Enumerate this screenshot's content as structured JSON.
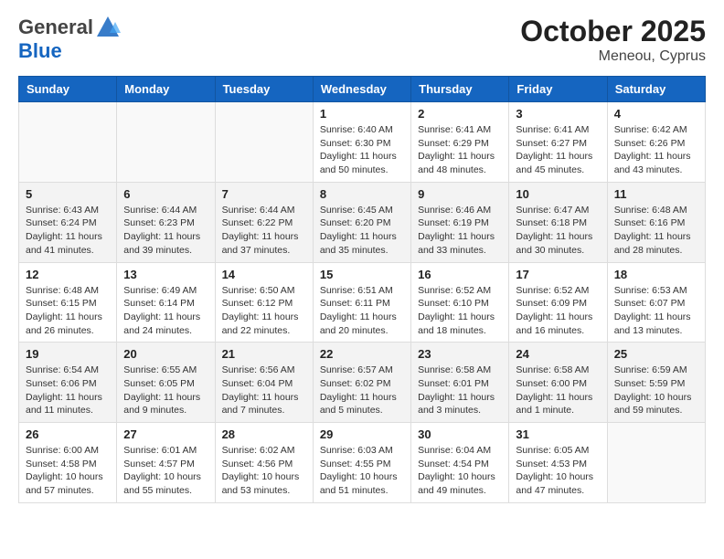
{
  "header": {
    "logo_line1": "General",
    "logo_line2": "Blue",
    "month": "October 2025",
    "location": "Meneou, Cyprus"
  },
  "days_of_week": [
    "Sunday",
    "Monday",
    "Tuesday",
    "Wednesday",
    "Thursday",
    "Friday",
    "Saturday"
  ],
  "weeks": [
    [
      {
        "day": "",
        "info": ""
      },
      {
        "day": "",
        "info": ""
      },
      {
        "day": "",
        "info": ""
      },
      {
        "day": "1",
        "info": "Sunrise: 6:40 AM\nSunset: 6:30 PM\nDaylight: 11 hours\nand 50 minutes."
      },
      {
        "day": "2",
        "info": "Sunrise: 6:41 AM\nSunset: 6:29 PM\nDaylight: 11 hours\nand 48 minutes."
      },
      {
        "day": "3",
        "info": "Sunrise: 6:41 AM\nSunset: 6:27 PM\nDaylight: 11 hours\nand 45 minutes."
      },
      {
        "day": "4",
        "info": "Sunrise: 6:42 AM\nSunset: 6:26 PM\nDaylight: 11 hours\nand 43 minutes."
      }
    ],
    [
      {
        "day": "5",
        "info": "Sunrise: 6:43 AM\nSunset: 6:24 PM\nDaylight: 11 hours\nand 41 minutes."
      },
      {
        "day": "6",
        "info": "Sunrise: 6:44 AM\nSunset: 6:23 PM\nDaylight: 11 hours\nand 39 minutes."
      },
      {
        "day": "7",
        "info": "Sunrise: 6:44 AM\nSunset: 6:22 PM\nDaylight: 11 hours\nand 37 minutes."
      },
      {
        "day": "8",
        "info": "Sunrise: 6:45 AM\nSunset: 6:20 PM\nDaylight: 11 hours\nand 35 minutes."
      },
      {
        "day": "9",
        "info": "Sunrise: 6:46 AM\nSunset: 6:19 PM\nDaylight: 11 hours\nand 33 minutes."
      },
      {
        "day": "10",
        "info": "Sunrise: 6:47 AM\nSunset: 6:18 PM\nDaylight: 11 hours\nand 30 minutes."
      },
      {
        "day": "11",
        "info": "Sunrise: 6:48 AM\nSunset: 6:16 PM\nDaylight: 11 hours\nand 28 minutes."
      }
    ],
    [
      {
        "day": "12",
        "info": "Sunrise: 6:48 AM\nSunset: 6:15 PM\nDaylight: 11 hours\nand 26 minutes."
      },
      {
        "day": "13",
        "info": "Sunrise: 6:49 AM\nSunset: 6:14 PM\nDaylight: 11 hours\nand 24 minutes."
      },
      {
        "day": "14",
        "info": "Sunrise: 6:50 AM\nSunset: 6:12 PM\nDaylight: 11 hours\nand 22 minutes."
      },
      {
        "day": "15",
        "info": "Sunrise: 6:51 AM\nSunset: 6:11 PM\nDaylight: 11 hours\nand 20 minutes."
      },
      {
        "day": "16",
        "info": "Sunrise: 6:52 AM\nSunset: 6:10 PM\nDaylight: 11 hours\nand 18 minutes."
      },
      {
        "day": "17",
        "info": "Sunrise: 6:52 AM\nSunset: 6:09 PM\nDaylight: 11 hours\nand 16 minutes."
      },
      {
        "day": "18",
        "info": "Sunrise: 6:53 AM\nSunset: 6:07 PM\nDaylight: 11 hours\nand 13 minutes."
      }
    ],
    [
      {
        "day": "19",
        "info": "Sunrise: 6:54 AM\nSunset: 6:06 PM\nDaylight: 11 hours\nand 11 minutes."
      },
      {
        "day": "20",
        "info": "Sunrise: 6:55 AM\nSunset: 6:05 PM\nDaylight: 11 hours\nand 9 minutes."
      },
      {
        "day": "21",
        "info": "Sunrise: 6:56 AM\nSunset: 6:04 PM\nDaylight: 11 hours\nand 7 minutes."
      },
      {
        "day": "22",
        "info": "Sunrise: 6:57 AM\nSunset: 6:02 PM\nDaylight: 11 hours\nand 5 minutes."
      },
      {
        "day": "23",
        "info": "Sunrise: 6:58 AM\nSunset: 6:01 PM\nDaylight: 11 hours\nand 3 minutes."
      },
      {
        "day": "24",
        "info": "Sunrise: 6:58 AM\nSunset: 6:00 PM\nDaylight: 11 hours\nand 1 minute."
      },
      {
        "day": "25",
        "info": "Sunrise: 6:59 AM\nSunset: 5:59 PM\nDaylight: 10 hours\nand 59 minutes."
      }
    ],
    [
      {
        "day": "26",
        "info": "Sunrise: 6:00 AM\nSunset: 4:58 PM\nDaylight: 10 hours\nand 57 minutes."
      },
      {
        "day": "27",
        "info": "Sunrise: 6:01 AM\nSunset: 4:57 PM\nDaylight: 10 hours\nand 55 minutes."
      },
      {
        "day": "28",
        "info": "Sunrise: 6:02 AM\nSunset: 4:56 PM\nDaylight: 10 hours\nand 53 minutes."
      },
      {
        "day": "29",
        "info": "Sunrise: 6:03 AM\nSunset: 4:55 PM\nDaylight: 10 hours\nand 51 minutes."
      },
      {
        "day": "30",
        "info": "Sunrise: 6:04 AM\nSunset: 4:54 PM\nDaylight: 10 hours\nand 49 minutes."
      },
      {
        "day": "31",
        "info": "Sunrise: 6:05 AM\nSunset: 4:53 PM\nDaylight: 10 hours\nand 47 minutes."
      },
      {
        "day": "",
        "info": ""
      }
    ]
  ]
}
